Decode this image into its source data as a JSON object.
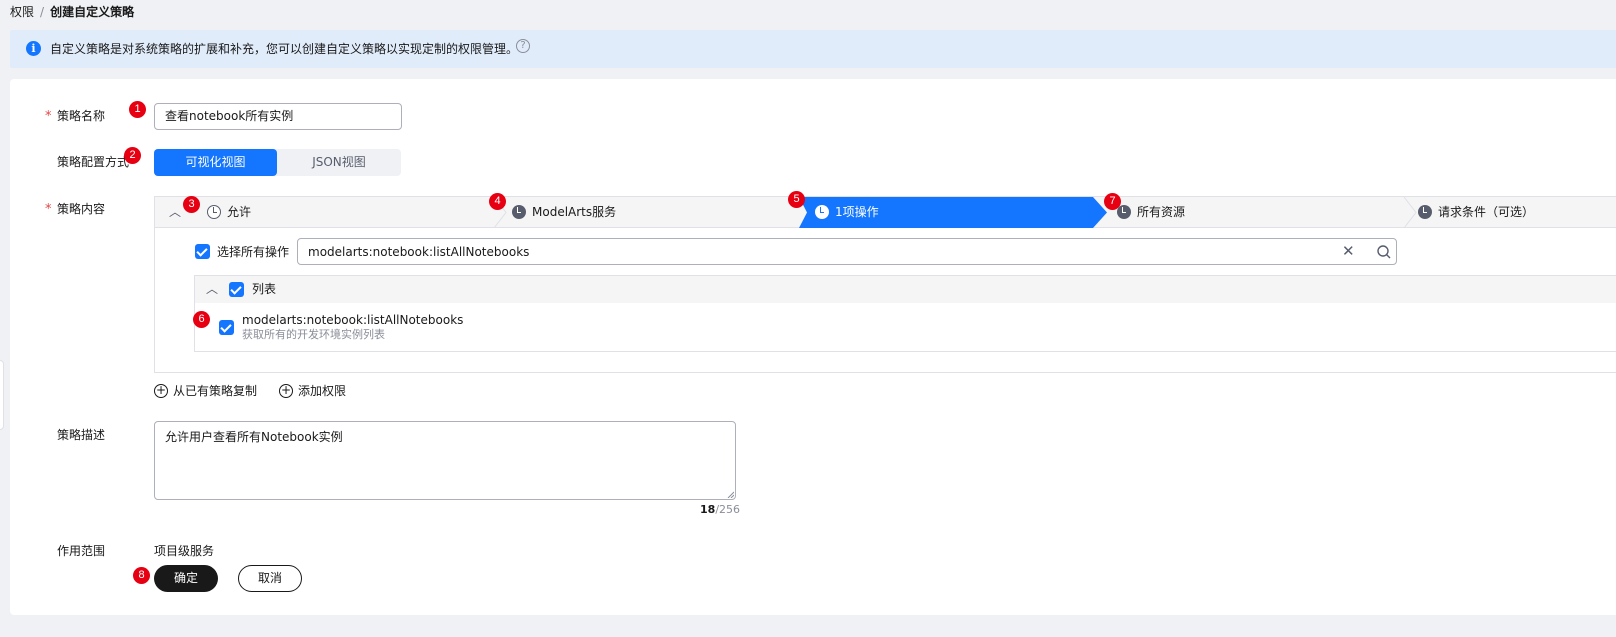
{
  "breadcrumb": {
    "parent": "权限",
    "separator": "/",
    "current": "创建自定义策略"
  },
  "info": {
    "icon": "info-icon",
    "text": "自定义策略是对系统策略的扩展和补充，您可以创建自定义策略以实现定制的权限管理。",
    "help_icon": "?"
  },
  "form": {
    "name_label": "策略名称",
    "name_value": "查看notebook所有实例",
    "mode_label": "策略配置方式",
    "mode_options": [
      "可视化视图",
      "JSON视图"
    ],
    "mode_selected": "可视化视图",
    "content_label": "策略内容",
    "desc_label": "策略描述",
    "desc_value": "允许用户查看所有Notebook实例",
    "desc_count": "18",
    "desc_max": "/256",
    "scope_label": "作用范围",
    "scope_value": "项目级服务",
    "required_mark": "*"
  },
  "policy": {
    "steps": [
      {
        "label": "允许",
        "icon": "clock-outline-icon"
      },
      {
        "label": "ModelArts服务",
        "icon": "clock-icon"
      },
      {
        "label": "1项操作",
        "icon": "clock-icon",
        "active": true
      },
      {
        "label": "所有资源",
        "icon": "clock-icon"
      },
      {
        "label": "请求条件（可选）",
        "icon": "clock-icon"
      }
    ],
    "select_all_label": "选择所有操作",
    "search_value": "modelarts:notebook:listAllNotebooks",
    "group_label": "列表",
    "item": {
      "title": "modelarts:notebook:listAllNotebooks",
      "desc": "获取所有的开发环境实例列表"
    },
    "actions": [
      "从已有策略复制",
      "添加权限"
    ]
  },
  "buttons": {
    "ok": "确定",
    "cancel": "取消"
  },
  "markers": [
    "1",
    "2",
    "3",
    "4",
    "5",
    "6",
    "7",
    "8"
  ],
  "colors": {
    "primary": "#1476ff",
    "marker": "#e60012",
    "dark_button": "#191919",
    "info_bg": "#e1ecfb"
  }
}
